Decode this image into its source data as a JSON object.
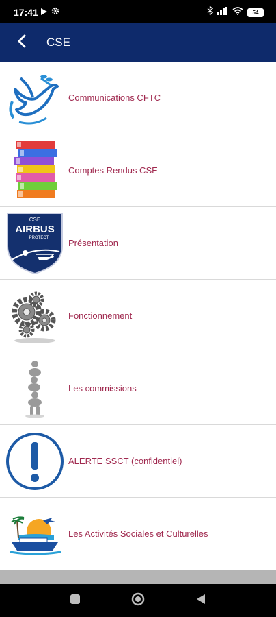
{
  "status_bar": {
    "time": "17:41",
    "battery": "54",
    "icons": [
      "play-icon",
      "settings-icon",
      "bluetooth-icon",
      "signal-icon",
      "wifi-icon",
      "battery-icon"
    ]
  },
  "header": {
    "title": "CSE",
    "back_icon": "chevron-left-icon",
    "background_color": "#0e2a6b"
  },
  "menu": {
    "label_color": "#a0294f",
    "items": [
      {
        "label": "Communications CFTC",
        "icon": "dove-icon"
      },
      {
        "label": "Comptes Rendus CSE",
        "icon": "binders-stack-icon"
      },
      {
        "label": "Présentation",
        "icon": "airbus-protect-badge-icon",
        "badge_text": "CSE",
        "badge_title": "AIRBUS",
        "badge_sub": "PROTECT"
      },
      {
        "label": "Fonctionnement",
        "icon": "gears-icon"
      },
      {
        "label": "Les commissions",
        "icon": "figures-stack-icon"
      },
      {
        "label": "ALERTE SSCT (confidentiel)",
        "icon": "alert-exclamation-icon"
      },
      {
        "label": "Les Activités Sociales et Culturelles",
        "icon": "holiday-cruise-icon"
      }
    ]
  },
  "nav": {
    "buttons": [
      "recents-square-icon",
      "home-circle-icon",
      "back-triangle-icon"
    ]
  }
}
